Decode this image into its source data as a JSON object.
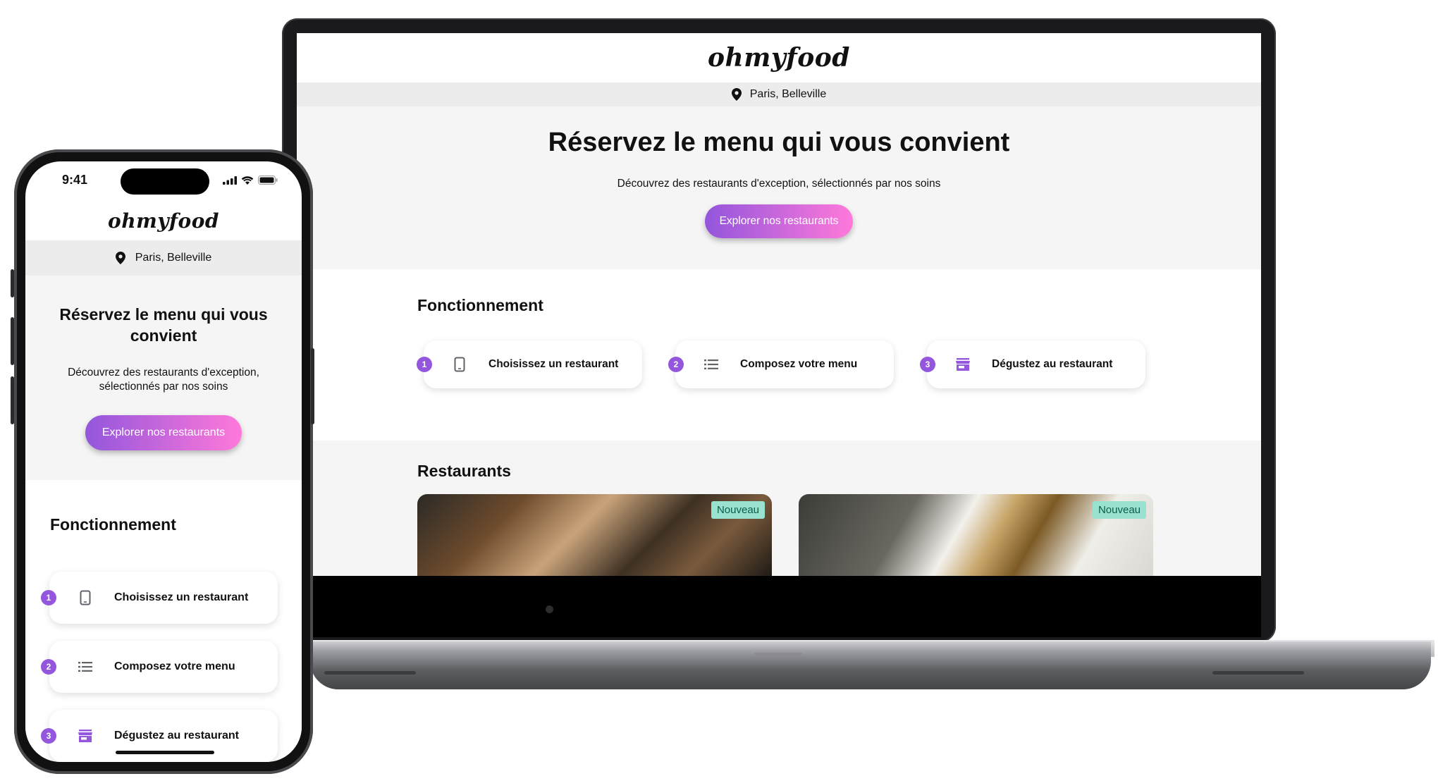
{
  "site": {
    "logo": "ohmyfood",
    "location": "Paris, Belleville",
    "hero": {
      "title": "Réservez le menu qui vous convient",
      "subtitle": "Découvrez des restaurants d'exception, sélectionnés par nos soins",
      "cta": "Explorer nos restaurants"
    },
    "how": {
      "title": "Fonctionnement",
      "steps": [
        {
          "num": "1",
          "label": "Choisissez un restaurant",
          "icon": "phone-icon"
        },
        {
          "num": "2",
          "label": "Composez votre menu",
          "icon": "list-icon"
        },
        {
          "num": "3",
          "label": "Dégustez au restaurant",
          "icon": "store-icon"
        }
      ]
    },
    "restaurants": {
      "title": "Restaurants",
      "badge": "Nouveau"
    }
  },
  "phone": {
    "time": "9:41"
  },
  "colors": {
    "accent_purple": "#9356dc",
    "accent_pink": "#ff79da",
    "badge_bg": "#99e2d0",
    "hero_bg": "#f5f5f5"
  }
}
